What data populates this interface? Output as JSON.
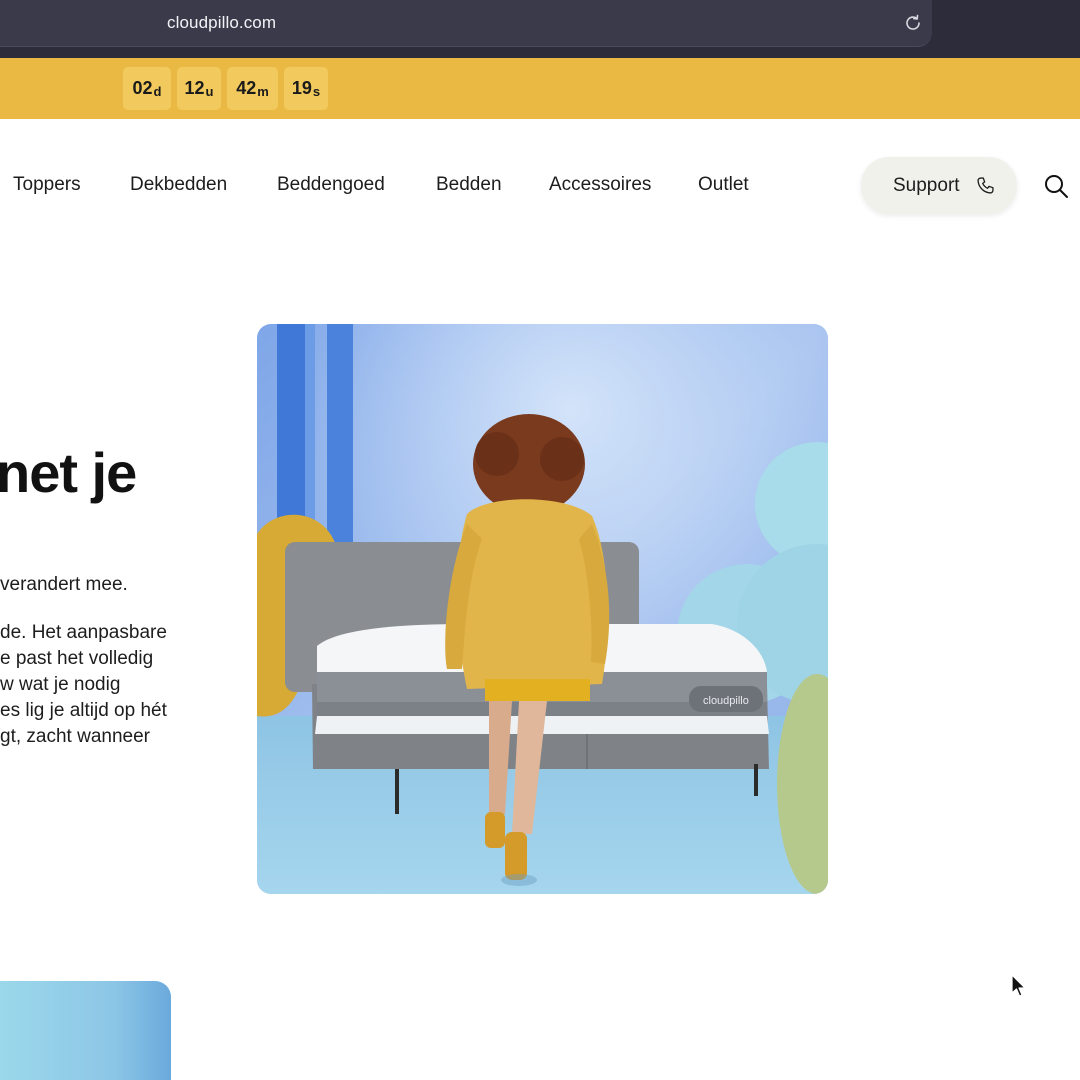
{
  "browser": {
    "url": "cloudpillo.com",
    "reload_icon": "reload-icon"
  },
  "promo": {
    "countdown": [
      {
        "value": "02",
        "unit": "d"
      },
      {
        "value": "12",
        "unit": "u"
      },
      {
        "value": "42",
        "unit": "m"
      },
      {
        "value": "19",
        "unit": "s"
      }
    ],
    "background": "#e9b944"
  },
  "nav": {
    "items": [
      "Toppers",
      "Dekbedden",
      "Beddengoed",
      "Bedden",
      "Accessoires",
      "Outlet"
    ],
    "support_label": "Support",
    "support_icon": "phone-icon",
    "search_icon": "search-icon"
  },
  "hero": {
    "title": "net je",
    "lead": "verandert mee.",
    "body_lines": [
      "de. Het aanpasbare",
      "e past het volledig",
      "w wat je nodig",
      "es lig je altijd op hét",
      "gt, zacht wanneer"
    ],
    "image_alt": "Woman in yellow outfit walking toward a grey bed with cloudpillo mattress",
    "mattress_brand": "cloudpillo"
  }
}
